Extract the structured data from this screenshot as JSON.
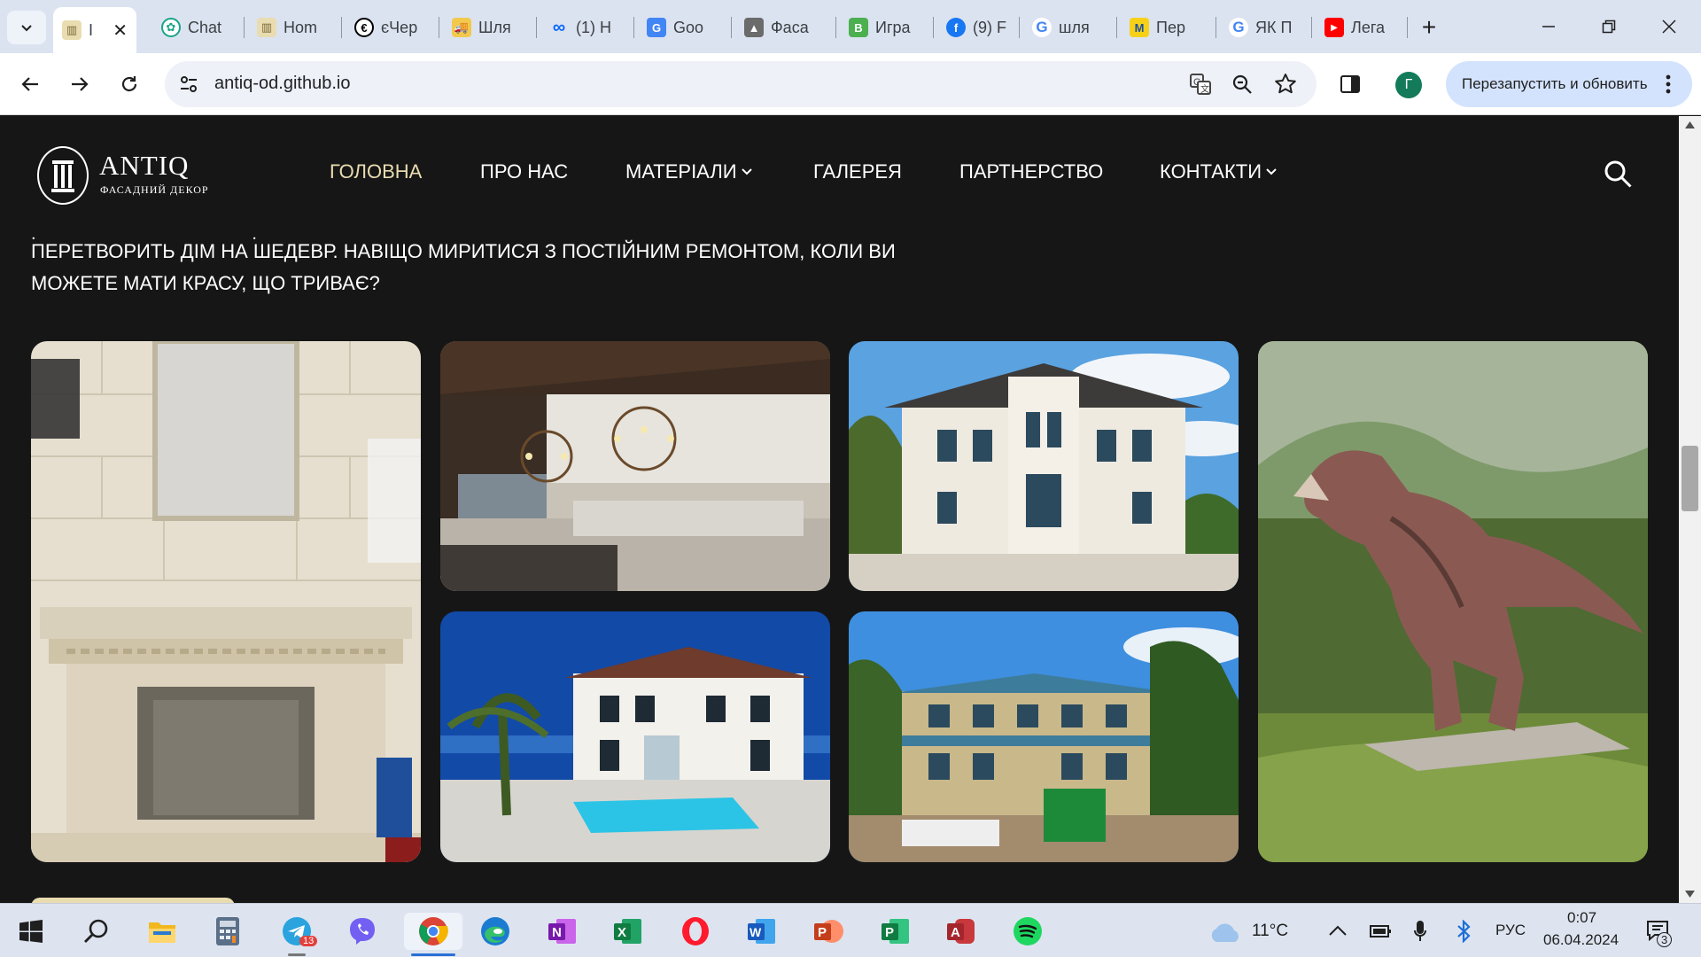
{
  "browser": {
    "tabs": [
      {
        "title": "I",
        "icon": "column-icon",
        "active": true
      },
      {
        "title": "Chat",
        "icon": "openai-icon"
      },
      {
        "title": "Hom",
        "icon": "column-icon"
      },
      {
        "title": "єЧер",
        "icon": "euro-icon"
      },
      {
        "title": "Шля",
        "icon": "truck-icon"
      },
      {
        "title": "(1) Н",
        "icon": "meta-icon"
      },
      {
        "title": "Goo",
        "icon": "translate-icon"
      },
      {
        "title": "Фаса",
        "icon": "building-icon"
      },
      {
        "title": "Игра",
        "icon": "letter-b-icon"
      },
      {
        "title": "(9) F",
        "icon": "facebook-icon"
      },
      {
        "title": "шля",
        "icon": "google-icon"
      },
      {
        "title": "Пер",
        "icon": "letter-m-icon"
      },
      {
        "title": "ЯК П",
        "icon": "google-icon"
      },
      {
        "title": "Лега",
        "icon": "youtube-icon"
      }
    ],
    "url": "antiq-od.github.io",
    "relaunch_label": "Перезапустить и обновить",
    "profile_initial": "Г"
  },
  "site": {
    "logo_name": "ANTIQ",
    "logo_sub": "ФАСАДНИЙ ДЕКОР",
    "nav": [
      {
        "label": "ГОЛОВНА",
        "active": true,
        "dropdown": false
      },
      {
        "label": "ПРО НАС",
        "active": false,
        "dropdown": false
      },
      {
        "label": "МАТЕРІАЛИ",
        "active": false,
        "dropdown": true
      },
      {
        "label": "ГАЛЕРЕЯ",
        "active": false,
        "dropdown": false
      },
      {
        "label": "ПАРТНЕРСТВО",
        "active": false,
        "dropdown": false
      },
      {
        "label": "КОНТАКТИ",
        "active": false,
        "dropdown": true
      }
    ],
    "intro_line1": "ПЕРЕТВОРИТЬ ДІМ НА ШЕДЕВР. НАВІЩО МИРИТИСЯ З ПОСТІЙНИМ РЕМОНТОМ, КОЛИ ВИ",
    "intro_line2": "МОЖЕТЕ МАТИ КРАСУ, ЩО ТРИВАЄ?",
    "gallery": [
      {
        "name": "fireplace-photo",
        "subject": "stone fireplace"
      },
      {
        "name": "kitchen-photo",
        "subject": "interior kitchen with chandeliers"
      },
      {
        "name": "villa-photo",
        "subject": "white villa facade"
      },
      {
        "name": "dinosaur-photo",
        "subject": "dinosaur statue in garden"
      },
      {
        "name": "pool-house-photo",
        "subject": "house with pool"
      },
      {
        "name": "construction-photo",
        "subject": "house under construction"
      }
    ]
  },
  "taskbar": {
    "weather": "11°C",
    "language": "РУС",
    "time": "0:07",
    "date": "06.04.2024",
    "notifications": "3",
    "telegram_badge": "13"
  },
  "colors": {
    "accent_gold": "#e9dcb0",
    "page_bg": "#161616",
    "tabstrip_bg": "#dbe3f1"
  }
}
